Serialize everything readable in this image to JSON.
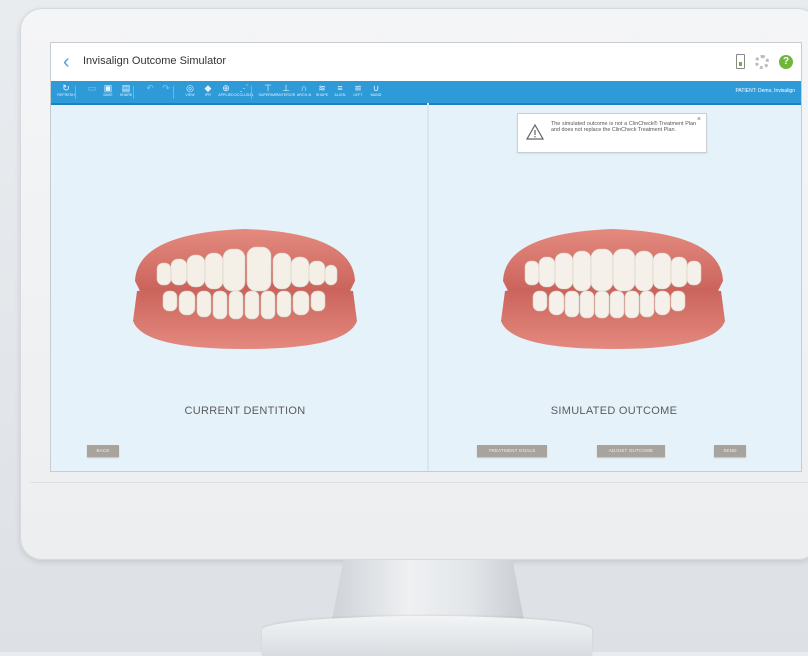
{
  "app": {
    "title": "Invisalign Outcome Simulator",
    "patient": "PATIENT: Demo, Invisalign"
  },
  "toolbar": {
    "tools": [
      {
        "icon": "refresh-icon",
        "glyph": "↻",
        "label": "REFRESH",
        "dim": false
      },
      {
        "icon": "save-icon",
        "glyph": "▭",
        "label": "",
        "dim": true
      },
      {
        "icon": "save-icon",
        "glyph": "▣",
        "label": "SAVE",
        "dim": false
      },
      {
        "icon": "share-icon",
        "glyph": "▤",
        "label": "SHARE",
        "dim": false
      },
      {
        "icon": "undo-icon",
        "glyph": "↶",
        "label": "",
        "dim": true
      },
      {
        "icon": "redo-icon",
        "glyph": "↷",
        "label": "",
        "dim": true
      },
      {
        "icon": "view-icon",
        "glyph": "◎",
        "label": "VIEW",
        "dim": false
      },
      {
        "icon": "ipr-icon",
        "glyph": "◆",
        "label": "IPR",
        "dim": false
      },
      {
        "icon": "attachments-icon",
        "glyph": "⊕",
        "label": "APPLIED",
        "dim": false
      },
      {
        "icon": "occlusal-icon",
        "glyph": "⋰",
        "label": "OCCLUSAL",
        "dim": false
      },
      {
        "icon": "superimpose-icon",
        "glyph": "⊤",
        "label": "SUPERIMP",
        "dim": false
      },
      {
        "icon": "anterior-icon",
        "glyph": "⊥",
        "label": "ANTERIOR",
        "dim": false
      },
      {
        "icon": "arch-icon",
        "glyph": "∩",
        "label": "ARCH-B",
        "dim": false
      },
      {
        "icon": "shape-icon",
        "glyph": "≋",
        "label": "SHAPE",
        "dim": false
      },
      {
        "icon": "align-icon",
        "glyph": "≡",
        "label": "ALIGN",
        "dim": false
      },
      {
        "icon": "left-icon",
        "glyph": "≌",
        "label": "LEFT",
        "dim": false
      },
      {
        "icon": "arch-view-icon",
        "glyph": "∪",
        "label": "MAND",
        "dim": false
      }
    ]
  },
  "notice": {
    "text": "The simulated outcome is not a ClinCheck® Treatment Plan and does not replace the ClinCheck Treatment Plan.",
    "close": "×"
  },
  "left_panel": {
    "caption": "CURRENT DENTITION",
    "back_label": "BACK"
  },
  "right_panel": {
    "caption": "SIMULATED OUTCOME",
    "treatment_goals_label": "TREATMENT GOALS",
    "adjust_outcome_label": "ADJUST OUTCOME",
    "send_label": "SEND"
  },
  "colors": {
    "accent": "#2f9ad8",
    "screen_bg": "#e6f2fa",
    "button": "#a8a39c",
    "gum": "#d9776d",
    "tooth": "#f3efe6",
    "help": "#6fb63a"
  }
}
